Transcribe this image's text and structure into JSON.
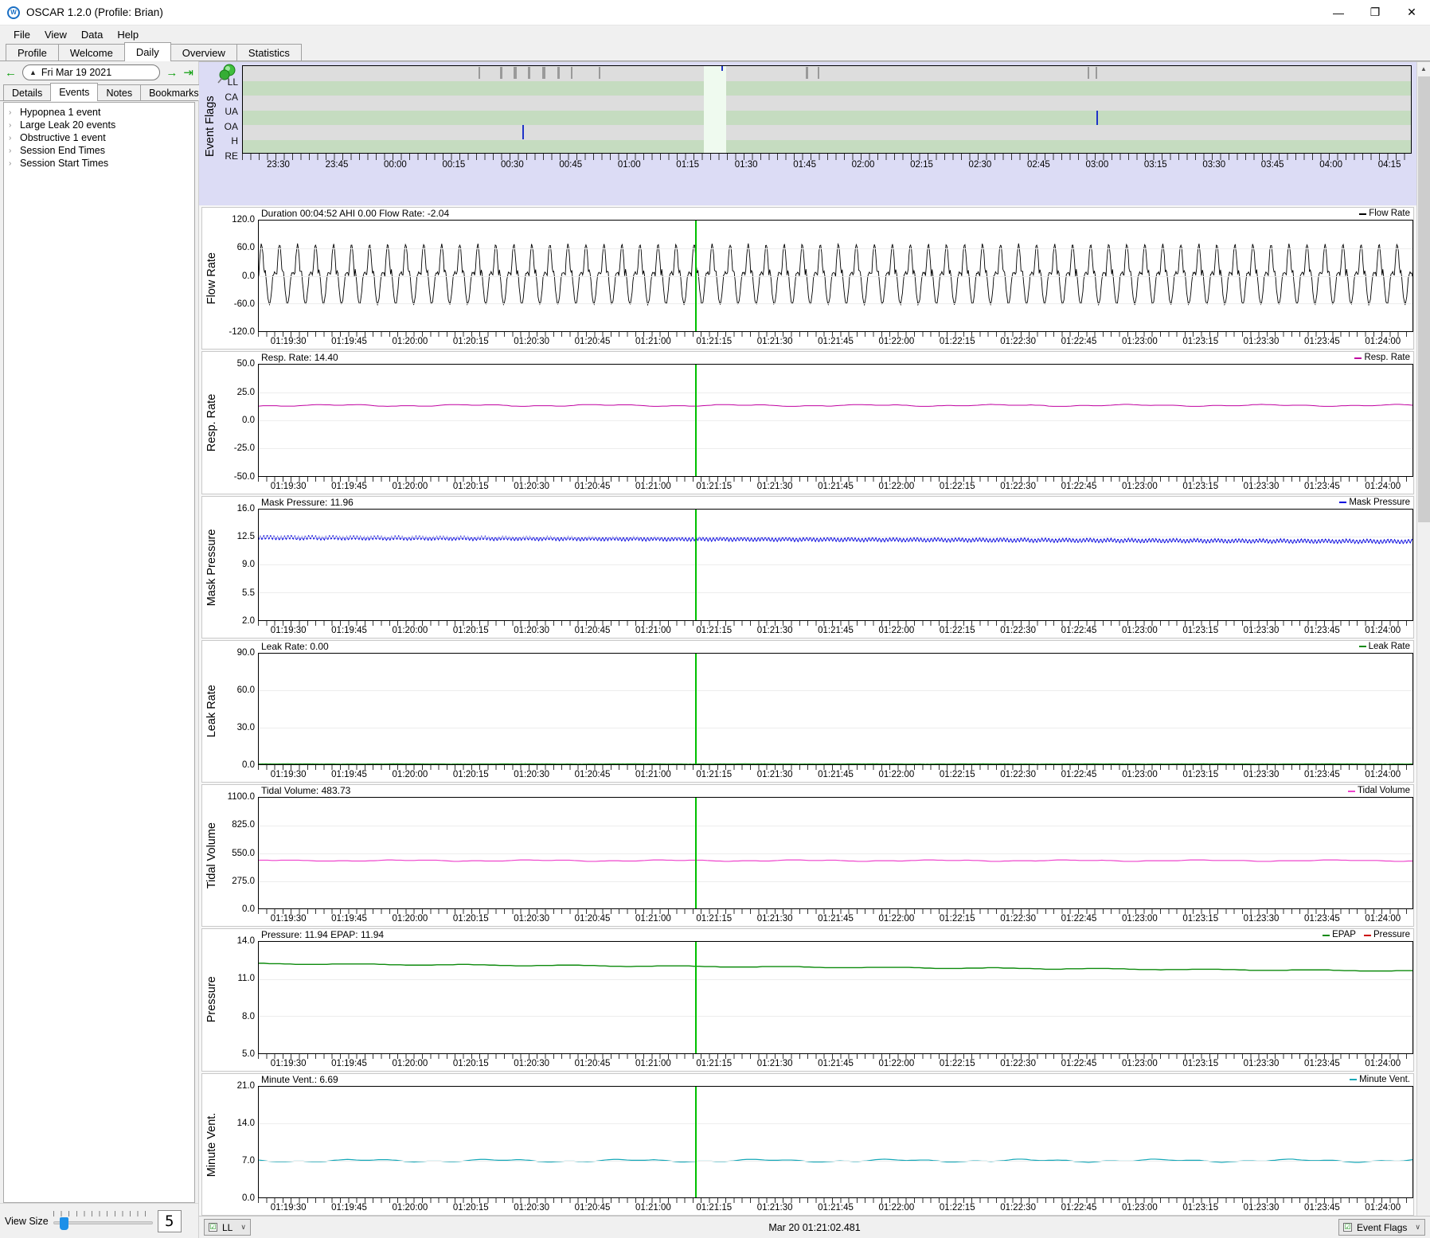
{
  "window": {
    "title": "OSCAR 1.2.0 (Profile: Brian)",
    "icon": "oscar-logo-icon",
    "minimize": "—",
    "maximize": "❐",
    "close": "✕"
  },
  "menubar": {
    "items": [
      "File",
      "View",
      "Data",
      "Help"
    ]
  },
  "tabs": {
    "items": [
      "Profile",
      "Welcome",
      "Daily",
      "Overview",
      "Statistics"
    ],
    "active": "Daily"
  },
  "date_nav": {
    "prev_label": "←",
    "next_label": "→",
    "end_label": "⇥",
    "date_value": "Fri Mar 19 2021",
    "caret": "▲"
  },
  "left_tabs": {
    "items": [
      "Details",
      "Events",
      "Notes",
      "Bookmarks"
    ],
    "active": "Events"
  },
  "events": {
    "items": [
      "Hypopnea 1 event",
      "Large Leak 20 events",
      "Obstructive 1 event",
      "Session End Times",
      "Session Start Times"
    ],
    "expander": "›"
  },
  "view_size": {
    "label": "View Size",
    "value": "5"
  },
  "event_flags": {
    "title": "Event Flags",
    "pin_icon": "pushpin-icon",
    "rows": [
      "LL",
      "CA",
      "UA",
      "OA",
      "H",
      "RE"
    ],
    "x_labels": [
      "23:30",
      "23:45",
      "00:00",
      "00:15",
      "00:30",
      "00:45",
      "01:00",
      "01:15",
      "01:30",
      "01:45",
      "02:00",
      "02:15",
      "02:30",
      "02:45",
      "03:00",
      "03:15",
      "03:30",
      "03:45",
      "04:00",
      "04:15"
    ]
  },
  "charts": [
    {
      "id": "flow-rate",
      "ytitle": "Flow Rate",
      "header": "Duration 00:04:52 AHI 0.00 Flow Rate: -2.04",
      "legend": [
        {
          "label": "Flow Rate",
          "color": "#000000"
        }
      ],
      "y_labels": [
        "120.0",
        "60.0",
        "0.0",
        "-60.0",
        "-120.0"
      ],
      "color": "#000000"
    },
    {
      "id": "resp-rate",
      "ytitle": "Resp. Rate",
      "header": "Resp. Rate: 14.40",
      "legend": [
        {
          "label": "Resp. Rate",
          "color": "#c000a0"
        }
      ],
      "y_labels": [
        "50.0",
        "25.0",
        "0.0",
        "-25.0",
        "-50.0"
      ],
      "color": "#c000a0"
    },
    {
      "id": "mask-pressure",
      "ytitle": "Mask Pressure",
      "header": "Mask Pressure: 11.96",
      "legend": [
        {
          "label": "Mask Pressure",
          "color": "#0000dd"
        }
      ],
      "y_labels": [
        "16.0",
        "12.5",
        "9.0",
        "5.5",
        "2.0"
      ],
      "color": "#0000dd"
    },
    {
      "id": "leak-rate",
      "ytitle": "Leak Rate",
      "header": "Leak Rate: 0.00",
      "legend": [
        {
          "label": "Leak Rate",
          "color": "#0c8a0c"
        }
      ],
      "y_labels": [
        "90.0",
        "60.0",
        "30.0",
        "0.0"
      ],
      "color": "#0c8a0c"
    },
    {
      "id": "tidal-volume",
      "ytitle": "Tidal Volume",
      "header": "Tidal Volume: 483.73",
      "legend": [
        {
          "label": "Tidal Volume",
          "color": "#ee44cc"
        }
      ],
      "y_labels": [
        "1100.0",
        "825.0",
        "550.0",
        "275.0",
        "0.0"
      ],
      "color": "#ee44cc"
    },
    {
      "id": "pressure",
      "ytitle": "Pressure",
      "header": "Pressure: 11.94 EPAP: 11.94",
      "legend": [
        {
          "label": "EPAP",
          "color": "#0c8a0c"
        },
        {
          "label": "Pressure",
          "color": "#cc0000"
        }
      ],
      "y_labels": [
        "14.0",
        "11.0",
        "8.0",
        "5.0"
      ],
      "color": "#0c8a0c"
    },
    {
      "id": "minute-vent",
      "ytitle": "Minute Vent.",
      "header": "Minute Vent.: 6.69",
      "legend": [
        {
          "label": "Minute Vent.",
          "color": "#15a8b8"
        }
      ],
      "y_labels": [
        "21.0",
        "14.0",
        "7.0",
        "0.0"
      ],
      "color": "#15a8b8"
    }
  ],
  "chart_x_labels": [
    "01:19:30",
    "01:19:45",
    "01:20:00",
    "01:20:15",
    "01:20:30",
    "01:20:45",
    "01:21:00",
    "01:21:15",
    "01:21:30",
    "01:21:45",
    "01:22:00",
    "01:22:15",
    "01:22:30",
    "01:22:45",
    "01:23:00",
    "01:23:15",
    "01:23:30",
    "01:23:45",
    "01:24:00"
  ],
  "bottom": {
    "left_combo": {
      "checkbox": "☑",
      "label": "LL",
      "caret": "∨"
    },
    "status": "Mar 20 01:21:02.481",
    "right_combo": {
      "checkbox": "☑",
      "label": "Event Flags",
      "caret": "∨"
    }
  },
  "scrollbar": {
    "up": "▲",
    "down": "▼"
  }
}
